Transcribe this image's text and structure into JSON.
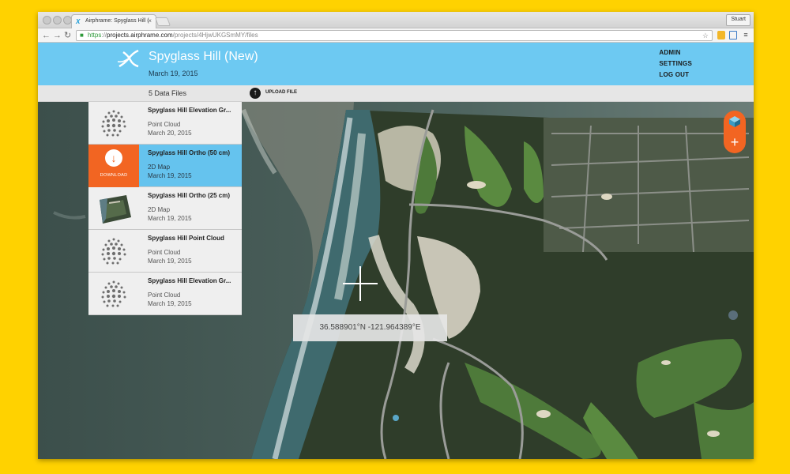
{
  "browser": {
    "tab_title": "Airphrame: Spyglass Hill (",
    "tab_close": "×",
    "profile_name": "Stuart",
    "url_https": "https",
    "url_sep": "://",
    "url_host": "projects.airphrame.com",
    "url_path": "/projects/4HjwUKGSmMY/files",
    "nav": {
      "back": "←",
      "forward": "→",
      "reload": "↻"
    },
    "star": "☆",
    "menu_icon": "≡"
  },
  "header": {
    "project_title": "Spyglass Hill (New)",
    "project_date": "March 19, 2015",
    "menu": [
      "ADMIN",
      "SETTINGS",
      "LOG OUT"
    ]
  },
  "subbar": {
    "file_count": "5 Data Files",
    "upload_label": "UPLOAD FILE"
  },
  "files": [
    {
      "name": "Spyglass Hill Elevation Gr...",
      "type": "Point Cloud",
      "date": "March 20, 2015",
      "thumb": "point-cloud-icon"
    },
    {
      "name": "Spyglass Hill Ortho (50 cm)",
      "type": "2D Map",
      "date": "March 19, 2015",
      "thumb": "download-icon",
      "action_label": "DOWNLOAD",
      "active": true
    },
    {
      "name": "Spyglass Hill Ortho (25 cm)",
      "type": "2D Map",
      "date": "March 19, 2015",
      "thumb": "ortho-thumbnail"
    },
    {
      "name": "Spyglass Hill Point Cloud",
      "type": "Point Cloud",
      "date": "March 19, 2015",
      "thumb": "point-cloud-icon"
    },
    {
      "name": "Spyglass Hill Elevation Gr...",
      "type": "Point Cloud",
      "date": "March 19, 2015",
      "thumb": "point-cloud-icon"
    }
  ],
  "map": {
    "coordinates": "36.588901°N -121.964389°E",
    "add_icon": "+",
    "colors": {
      "accent": "#f26522",
      "header": "#6dc9f2",
      "ocean": "#3f5450",
      "forest": "#2d3b25",
      "fairway": "#4e7a3a"
    }
  }
}
